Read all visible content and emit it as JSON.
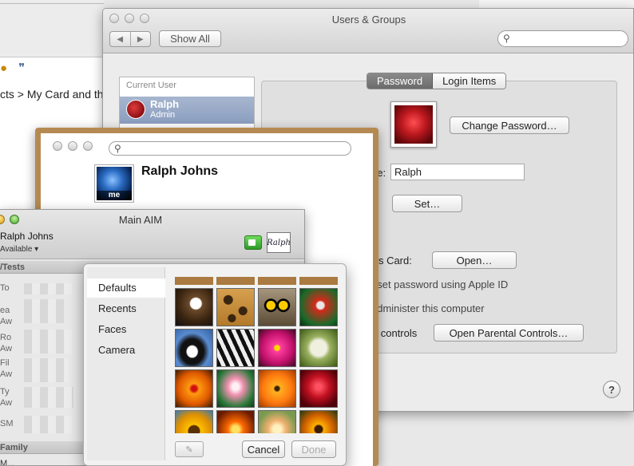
{
  "background": {
    "breadcrumb": "cts > My Card and th",
    "icon_left": "star-icon",
    "icon_right": "speech-bubble-icon"
  },
  "users_groups": {
    "title": "Users & Groups",
    "show_all": "Show All",
    "user_list_header": "Current User",
    "user_name": "Ralph",
    "user_role": "Admin",
    "tabs": [
      "Password",
      "Login Items"
    ],
    "change_password": "Change Password…",
    "full_name_label": "ne:",
    "full_name_value": "Ralph",
    "apple_id_label": "D:",
    "set_button": "Set…",
    "contacts_card_label": "tacts Card:",
    "open_button": "Open…",
    "reset_password_text": "eset password using Apple ID",
    "administer_text": "administer this computer",
    "parental_label": "al controls",
    "open_parental_button": "Open Parental Controls…",
    "help": "?"
  },
  "card": {
    "name": "Ralph Johns",
    "pic_badge": "me"
  },
  "aim": {
    "title": "Main AIM",
    "screen_name": "Ralph Johns",
    "status": "Available ▾",
    "group_tests": "/Tests",
    "group_family": "Family",
    "buddy_fragments": [
      "To",
      "ea",
      "Aw",
      "Ro",
      "Aw",
      "Fil",
      "Aw",
      "Ty",
      "Aw",
      "SM"
    ],
    "bottom_fragment": "M..."
  },
  "picker": {
    "categories": [
      "Defaults",
      "Recents",
      "Faces",
      "Camera"
    ],
    "active_category": "Defaults",
    "tiles": [
      "eagle",
      "leopard",
      "owl",
      "parrot",
      "penguin",
      "zebra",
      "pink-flower",
      "dandelion",
      "ladybug",
      "lotus",
      "poppy",
      "red-rose",
      "sunflower",
      "flame-flower",
      "yellow-rose",
      "yellow-daisy"
    ],
    "cancel": "Cancel",
    "done": "Done"
  }
}
